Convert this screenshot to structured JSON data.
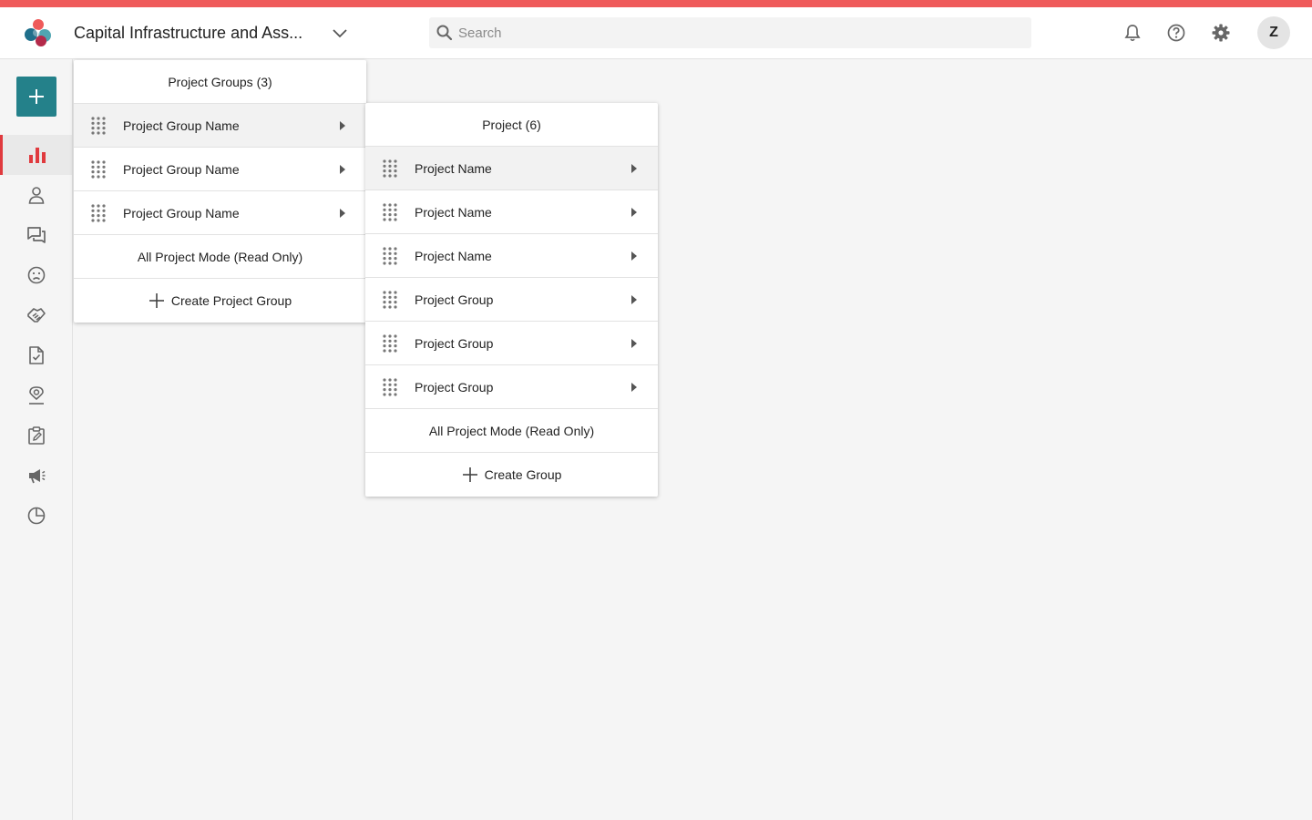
{
  "header": {
    "project_title": "Capital Infrastructure and Ass...",
    "search_placeholder": "Search",
    "avatar_initial": "Z"
  },
  "colors": {
    "accent_bar": "#ef5b5b",
    "primary": "#24818a",
    "active_nav": "#e03a3e"
  },
  "sidebar": {
    "items": [
      {
        "icon": "bar-chart-icon",
        "active": true
      },
      {
        "icon": "person-icon"
      },
      {
        "icon": "chat-icon"
      },
      {
        "icon": "sad-face-icon"
      },
      {
        "icon": "handshake-icon"
      },
      {
        "icon": "file-check-icon"
      },
      {
        "icon": "location-person-icon"
      },
      {
        "icon": "clipboard-edit-icon"
      },
      {
        "icon": "megaphone-icon"
      },
      {
        "icon": "pie-chart-icon"
      }
    ]
  },
  "groups_panel": {
    "header": "Project Groups (3)",
    "items": [
      {
        "label": "Project Group Name"
      },
      {
        "label": "Project Group Name"
      },
      {
        "label": "Project Group Name"
      }
    ],
    "all_mode": "All Project Mode (Read Only)",
    "create": "Create Project Group"
  },
  "projects_panel": {
    "header": "Project (6)",
    "items": [
      {
        "label": "Project Name"
      },
      {
        "label": "Project Name"
      },
      {
        "label": "Project Name"
      },
      {
        "label": "Project Group"
      },
      {
        "label": "Project Group"
      },
      {
        "label": "Project Group"
      }
    ],
    "all_mode": "All Project Mode (Read Only)",
    "create": "Create Group"
  }
}
